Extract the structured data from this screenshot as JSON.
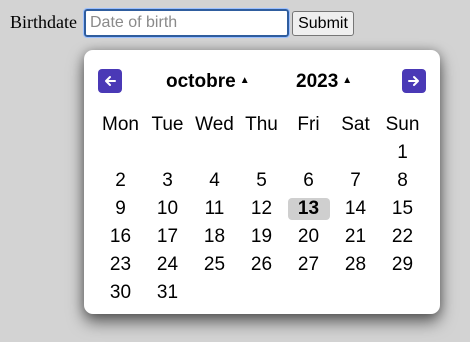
{
  "form": {
    "label": "Birthdate",
    "input_placeholder": "Date of birth",
    "input_value": "",
    "submit_label": "Submit"
  },
  "calendar": {
    "month": "octobre",
    "year": "2023",
    "prev_icon": "arrow-left-icon",
    "next_icon": "arrow-right-icon",
    "accent_color": "#4a39b6",
    "weekdays": [
      "Mon",
      "Tue",
      "Wed",
      "Thu",
      "Fri",
      "Sat",
      "Sun"
    ],
    "days": [
      "",
      "",
      "",
      "",
      "",
      "",
      "1",
      "2",
      "3",
      "4",
      "5",
      "6",
      "7",
      "8",
      "9",
      "10",
      "11",
      "12",
      "13",
      "14",
      "15",
      "16",
      "17",
      "18",
      "19",
      "20",
      "21",
      "22",
      "23",
      "24",
      "25",
      "26",
      "27",
      "28",
      "29",
      "30",
      "31",
      "",
      "",
      "",
      "",
      ""
    ],
    "highlighted_day": "13"
  }
}
